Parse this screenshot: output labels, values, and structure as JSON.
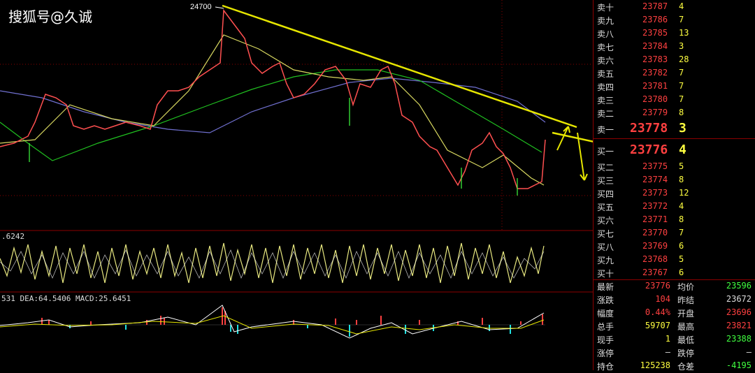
{
  "watermark": "搜狐号@久诚",
  "main_chart": {
    "peak_label": "24700"
  },
  "indicators": {
    "osc_label": ".6242",
    "macd_label": "531 DEA:64.5406 MACD:25.6451"
  },
  "order_book": {
    "asks": [
      {
        "label": "卖十",
        "price": "23787",
        "volume": "4"
      },
      {
        "label": "卖九",
        "price": "23786",
        "volume": "7"
      },
      {
        "label": "卖八",
        "price": "23785",
        "volume": "13"
      },
      {
        "label": "卖七",
        "price": "23784",
        "volume": "3"
      },
      {
        "label": "卖六",
        "price": "23783",
        "volume": "28"
      },
      {
        "label": "卖五",
        "price": "23782",
        "volume": "7"
      },
      {
        "label": "卖四",
        "price": "23781",
        "volume": "7"
      },
      {
        "label": "卖三",
        "price": "23780",
        "volume": "7"
      },
      {
        "label": "卖二",
        "price": "23779",
        "volume": "8"
      },
      {
        "label": "卖一",
        "price": "23778",
        "volume": "3"
      }
    ],
    "bids": [
      {
        "label": "买一",
        "price": "23776",
        "volume": "4"
      },
      {
        "label": "买二",
        "price": "23775",
        "volume": "5"
      },
      {
        "label": "买三",
        "price": "23774",
        "volume": "8"
      },
      {
        "label": "买四",
        "price": "23773",
        "volume": "12"
      },
      {
        "label": "买五",
        "price": "23772",
        "volume": "4"
      },
      {
        "label": "买六",
        "price": "23771",
        "volume": "8"
      },
      {
        "label": "买七",
        "price": "23770",
        "volume": "7"
      },
      {
        "label": "买八",
        "price": "23769",
        "volume": "6"
      },
      {
        "label": "买九",
        "price": "23768",
        "volume": "5"
      },
      {
        "label": "买十",
        "price": "23767",
        "volume": "6"
      }
    ]
  },
  "stats": [
    {
      "l1": "最新",
      "v1": "23776",
      "c1": "#ff4040",
      "l2": "均价",
      "v2": "23596",
      "c2": "#40ff40"
    },
    {
      "l1": "涨跌",
      "v1": "104",
      "c1": "#ff4040",
      "l2": "昨结",
      "v2": "23672",
      "c2": "#dddddd"
    },
    {
      "l1": "幅度",
      "v1": "0.44%",
      "c1": "#ff4040",
      "l2": "开盘",
      "v2": "23696",
      "c2": "#ff4040"
    },
    {
      "l1": "总手",
      "v1": "59707",
      "c1": "#ffff40",
      "l2": "最高",
      "v2": "23821",
      "c2": "#ff4040"
    },
    {
      "l1": "现手",
      "v1": "1",
      "c1": "#ffff40",
      "l2": "最低",
      "v2": "23388",
      "c2": "#40ff40"
    },
    {
      "l1": "涨停",
      "v1": "—",
      "c1": "#dddddd",
      "l2": "跌停",
      "v2": "—",
      "c2": "#dddddd"
    },
    {
      "l1": "持仓",
      "v1": "125238",
      "c1": "#ffff40",
      "l2": "仓差",
      "v2": "-4195",
      "c2": "#40ff40"
    }
  ],
  "colors": {
    "up": "#ff4040",
    "down": "#40ff40",
    "volume": "#ffff40",
    "trendline": "#e6e600",
    "grid": "#8b0000"
  }
}
